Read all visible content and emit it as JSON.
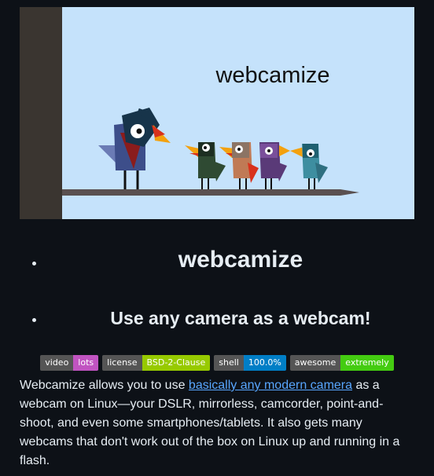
{
  "banner": {
    "title": "webcamize",
    "colors": {
      "sky": "#c5e2fb",
      "post": "#3a3530",
      "branch": "#5a5050"
    }
  },
  "headings": {
    "h1": "webcamize",
    "h2": "Use any camera as a webcam!"
  },
  "badges": [
    {
      "label": "video",
      "value": "lots",
      "color": "#c154c1"
    },
    {
      "label": "license",
      "value": "BSD-2-Clause",
      "color": "#97ca00"
    },
    {
      "label": "shell",
      "value": "100.0%",
      "color": "#007ec6"
    },
    {
      "label": "awesome",
      "value": "extremely",
      "color": "#4c1"
    }
  ],
  "intro": {
    "before": "Webcamize allows you to use ",
    "link": "basically any modern camera",
    "after": " as a webcam on Linux—your DSLR, mirrorless, camcorder, point-and-shoot, and even some smartphones/tablets. It also gets many webcams that don't work out of the box on Linux up and running in a flash."
  }
}
